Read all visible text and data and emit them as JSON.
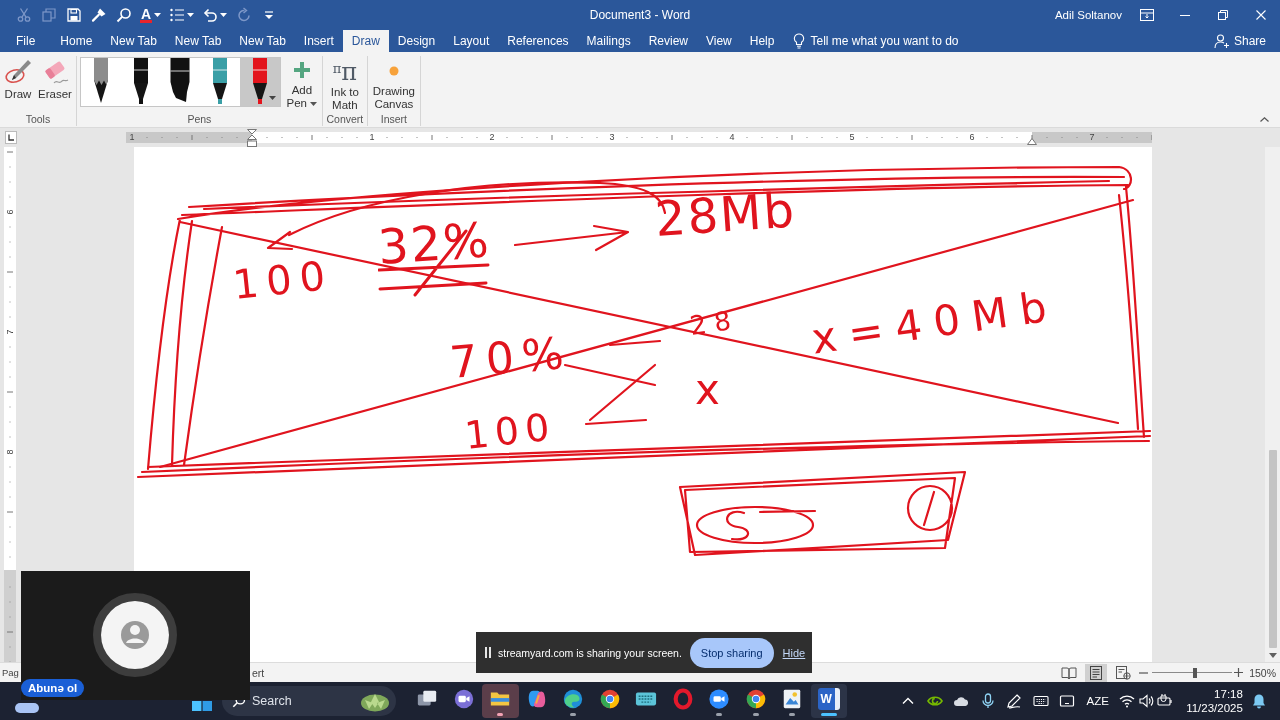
{
  "quick_access": [
    {
      "kind": "cut",
      "disabled": true,
      "dropdown": false
    },
    {
      "kind": "copy",
      "disabled": true,
      "dropdown": false
    },
    {
      "kind": "save",
      "disabled": false,
      "dropdown": false
    },
    {
      "kind": "painter",
      "disabled": false,
      "dropdown": false
    },
    {
      "kind": "search",
      "disabled": false,
      "dropdown": false
    },
    {
      "kind": "font_color",
      "glyph": "A",
      "disabled": false,
      "dropdown": true
    },
    {
      "kind": "bullets",
      "disabled": false,
      "dropdown": true
    },
    {
      "kind": "undo",
      "disabled": false,
      "dropdown": true
    },
    {
      "kind": "redo",
      "disabled": true,
      "dropdown": false
    },
    {
      "kind": "customize",
      "disabled": false,
      "dropdown": false
    }
  ],
  "window": {
    "title": "Document3  -  Word",
    "user": "Adil Soltanov"
  },
  "menu_tabs": [
    {
      "label": "File",
      "selected": false
    },
    {
      "label": "Home",
      "selected": false
    },
    {
      "label": "New Tab",
      "selected": false
    },
    {
      "label": "New Tab",
      "selected": false
    },
    {
      "label": "New Tab",
      "selected": false
    },
    {
      "label": "Insert",
      "selected": false
    },
    {
      "label": "Draw",
      "selected": true
    },
    {
      "label": "Design",
      "selected": false
    },
    {
      "label": "Layout",
      "selected": false
    },
    {
      "label": "References",
      "selected": false
    },
    {
      "label": "Mailings",
      "selected": false
    },
    {
      "label": "Review",
      "selected": false
    },
    {
      "label": "View",
      "selected": false
    },
    {
      "label": "Help",
      "selected": false
    }
  ],
  "tell_me": {
    "placeholder": "Tell me what you want to do"
  },
  "share": "Share",
  "ribbon": {
    "groups": [
      {
        "label": "Tools",
        "items": [
          {
            "kind": "draw",
            "label": "Draw"
          },
          {
            "kind": "eraser",
            "label": "Eraser"
          }
        ]
      },
      {
        "label": "Pens",
        "pens": [
          {
            "kind": "pencil",
            "color": "#8c8c8c",
            "selected": false
          },
          {
            "kind": "pen",
            "color": "#111111",
            "selected": false
          },
          {
            "kind": "marker",
            "color": "#111111",
            "selected": false
          },
          {
            "kind": "pen",
            "color": "#3a9fa6",
            "selected": false
          },
          {
            "kind": "pen",
            "color": "#e3141c",
            "selected": true
          }
        ],
        "items": [
          {
            "kind": "add_pen",
            "label": "Add Pen"
          }
        ]
      },
      {
        "label": "Convert",
        "items": [
          {
            "kind": "ink_math",
            "label": "Ink to Math",
            "icon_glyphs": [
              "π",
              "π"
            ]
          }
        ]
      },
      {
        "label": "Insert",
        "items": [
          {
            "kind": "canvas",
            "label": "Drawing Canvas"
          }
        ]
      }
    ]
  },
  "ruler": {
    "numbers": [
      "1",
      "1",
      "2",
      "3",
      "4",
      "5",
      "6",
      "7"
    ]
  },
  "vertical_ruler": {
    "numbers": [
      "6",
      "7",
      "8"
    ]
  },
  "document": {
    "ink_texts": [
      {
        "text": "100",
        "crossed_out": false
      },
      {
        "text": "32%",
        "crossed_out": true
      },
      {
        "text": "28Mb",
        "crossed_out": false
      },
      {
        "text": "70%",
        "crossed_out": false
      },
      {
        "text": "28",
        "crossed_out": false
      },
      {
        "text": "x=40Mb",
        "crossed_out": false
      },
      {
        "text": "100",
        "crossed_out": false
      },
      {
        "text": "x",
        "crossed_out": false
      }
    ]
  },
  "status_bar": {
    "texts": [
      "Pag",
      "ert"
    ],
    "views": [
      {
        "kind": "read",
        "selected": false
      },
      {
        "kind": "print",
        "selected": true
      },
      {
        "kind": "web",
        "selected": false
      }
    ],
    "zoom": {
      "level": 0.53,
      "reading": "150%"
    }
  },
  "taskbar": {
    "search": {
      "placeholder": "Search"
    },
    "apps": [
      {
        "kind": "task_view",
        "running": false,
        "active": false,
        "flashing": false
      },
      {
        "kind": "meet",
        "running": false,
        "active": false,
        "flashing": false
      },
      {
        "kind": "explorer",
        "running": true,
        "active": false,
        "flashing": true
      },
      {
        "kind": "copilot",
        "running": false,
        "active": false,
        "flashing": false
      },
      {
        "kind": "edge",
        "running": true,
        "active": false,
        "flashing": false
      },
      {
        "kind": "chrome",
        "running": false,
        "active": false,
        "flashing": false
      },
      {
        "kind": "keyboard_app",
        "running": false,
        "active": false,
        "flashing": false
      },
      {
        "kind": "opera",
        "running": false,
        "active": false,
        "flashing": false
      },
      {
        "kind": "zoom",
        "running": true,
        "active": false,
        "flashing": false
      },
      {
        "kind": "chrome",
        "running": true,
        "active": false,
        "flashing": false
      },
      {
        "kind": "paint",
        "running": true,
        "active": false,
        "flashing": false
      },
      {
        "kind": "word",
        "glyph": "W",
        "running": true,
        "active": true,
        "flashing": false
      }
    ],
    "tray": [
      {
        "kind": "chevron"
      },
      {
        "kind": "nvidia"
      },
      {
        "kind": "onedrive"
      },
      {
        "kind": "mic"
      },
      {
        "kind": "pen"
      },
      {
        "kind": "keyboard"
      },
      {
        "kind": "tablet"
      }
    ],
    "language": "AZE",
    "status_icons": [
      {
        "kind": "wifi"
      },
      {
        "kind": "volume"
      },
      {
        "kind": "battery"
      }
    ],
    "time": "17:18",
    "date": "11/23/2025"
  },
  "camera_tile": {
    "badge": "Abunə ol"
  },
  "share_bar": {
    "message": "streamyard.com is sharing your screen.",
    "stop_button": "Stop sharing",
    "hide_link": "Hide"
  }
}
